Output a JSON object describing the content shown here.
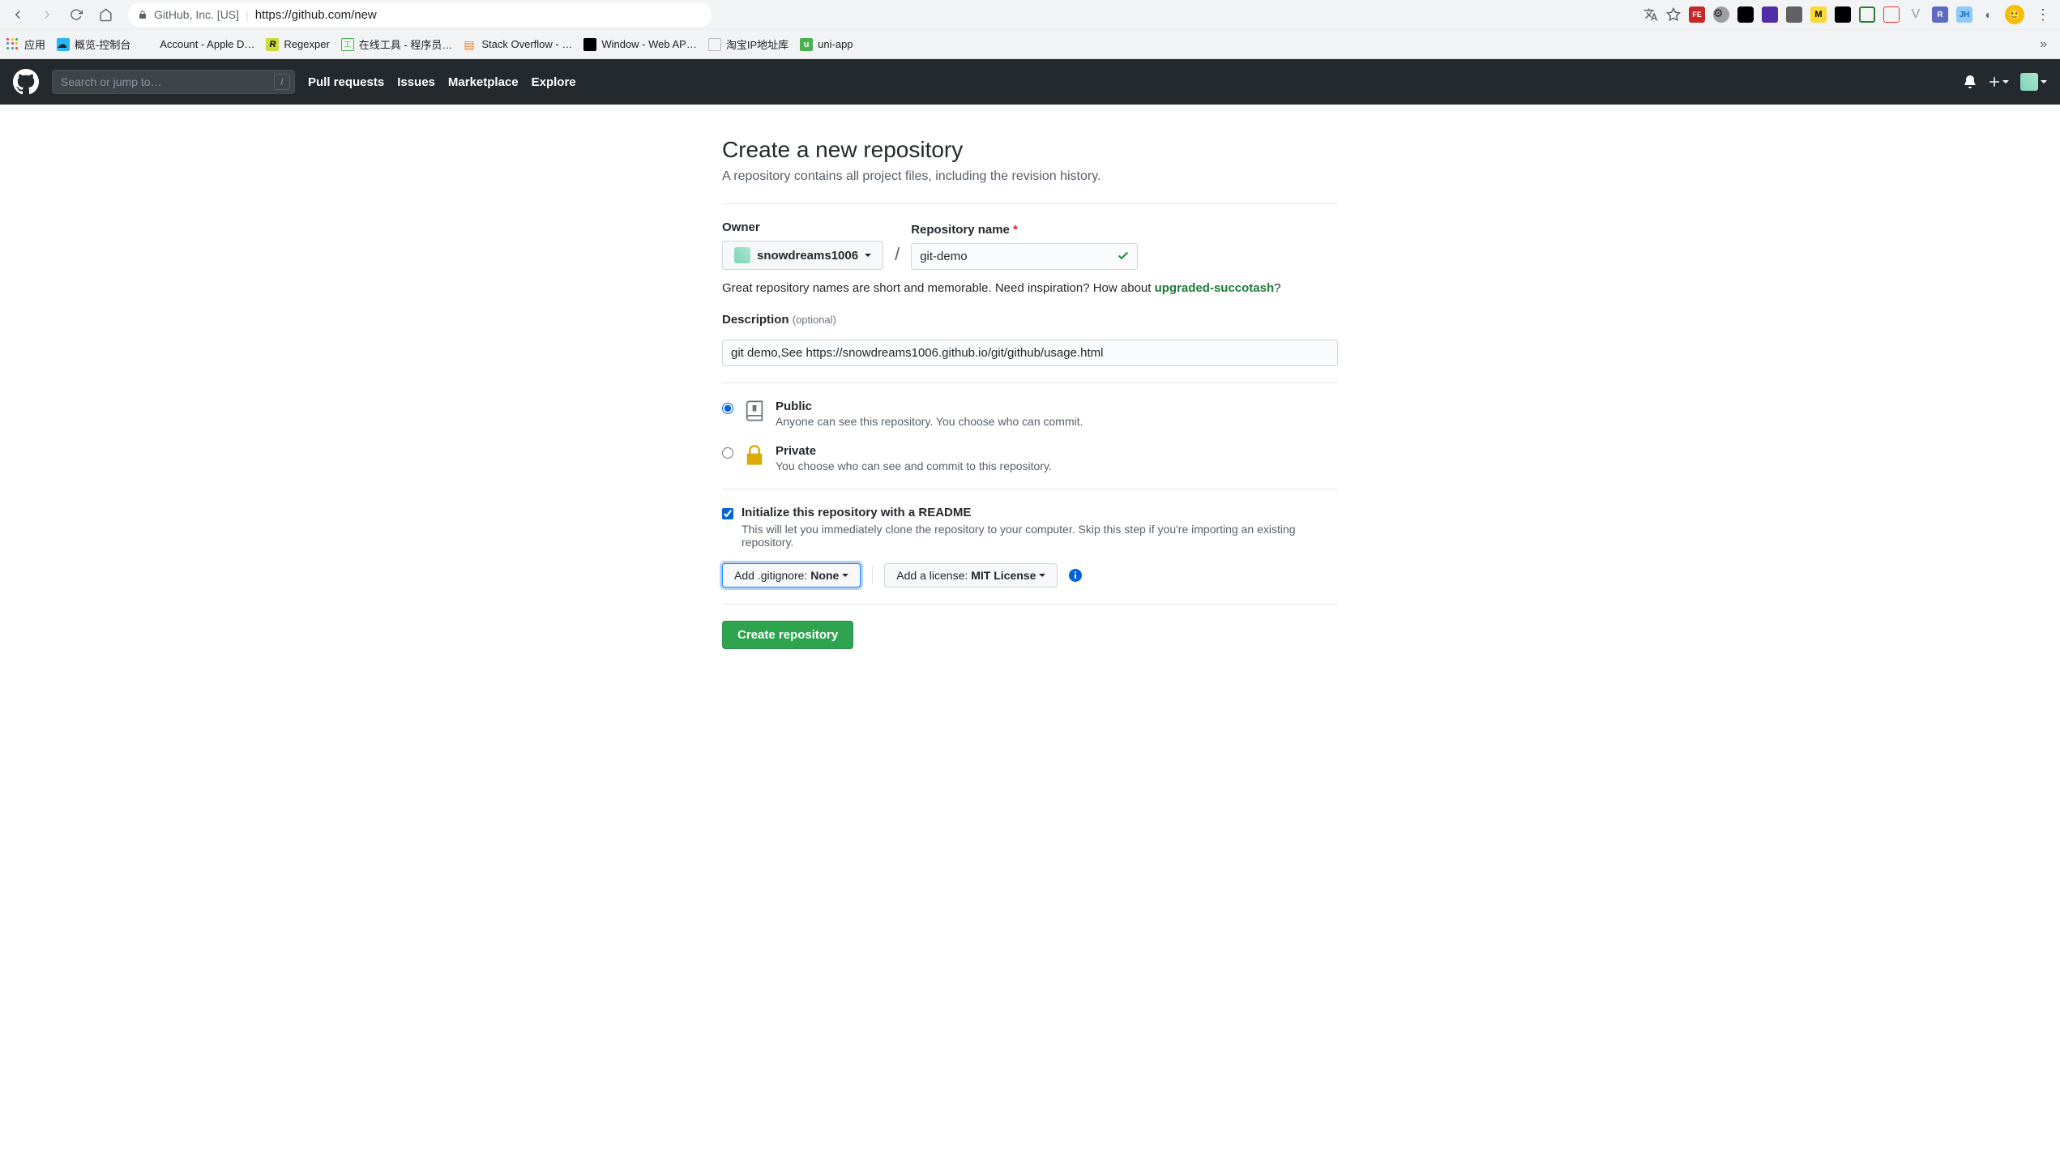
{
  "browser": {
    "site_label": "GitHub, Inc. [US]",
    "url": "https://github.com/new",
    "bookmarks": {
      "apps": "应用",
      "items": [
        {
          "label": "概览-控制台"
        },
        {
          "label": "Account - Apple D…"
        },
        {
          "label": "Regexper"
        },
        {
          "label": "在线工具 - 程序员…"
        },
        {
          "label": "Stack Overflow - …"
        },
        {
          "label": "Window - Web AP…"
        },
        {
          "label": "淘宝IP地址库"
        },
        {
          "label": "uni-app"
        }
      ]
    }
  },
  "github_nav": {
    "search_placeholder": "Search or jump to…",
    "slash": "/",
    "links": {
      "pull": "Pull requests",
      "issues": "Issues",
      "marketplace": "Marketplace",
      "explore": "Explore"
    }
  },
  "page": {
    "title": "Create a new repository",
    "subtitle": "A repository contains all project files, including the revision history."
  },
  "form": {
    "owner_label": "Owner",
    "owner_value": "snowdreams1006",
    "repo_label": "Repository name",
    "repo_value": "git-demo",
    "suggestion_prefix": "Great repository names are short and memorable. Need inspiration? How about ",
    "suggestion_name": "upgraded-succotash",
    "suggestion_suffix": "?",
    "desc_label": "Description",
    "desc_optional": "(optional)",
    "desc_value": "git demo,See https://snowdreams1006.github.io/git/github/usage.html",
    "visibility": {
      "public_title": "Public",
      "public_desc": "Anyone can see this repository. You choose who can commit.",
      "private_title": "Private",
      "private_desc": "You choose who can see and commit to this repository."
    },
    "readme": {
      "title": "Initialize this repository with a README",
      "desc": "This will let you immediately clone the repository to your computer. Skip this step if you're importing an existing repository."
    },
    "gitignore_label": "Add .gitignore: ",
    "gitignore_value": "None",
    "license_label": "Add a license: ",
    "license_value": "MIT License",
    "submit": "Create repository"
  }
}
